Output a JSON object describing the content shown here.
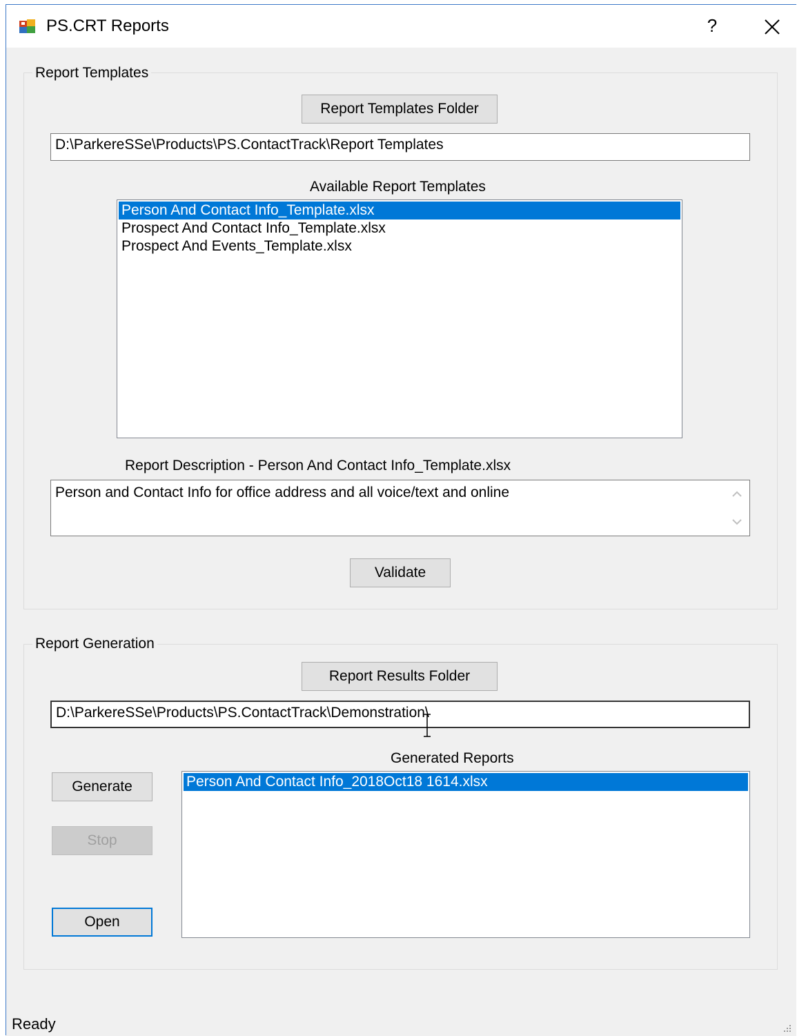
{
  "window": {
    "title": "PS.CRT Reports",
    "help_label": "?"
  },
  "templates_group": {
    "title": "Report Templates",
    "folder_button": "Report Templates Folder",
    "folder_path": "D:\\ParkereSSe\\Products\\PS.ContactTrack\\Report Templates",
    "available_label": "Available Report Templates",
    "items": [
      {
        "label": "Person And Contact Info_Template.xlsx",
        "selected": true
      },
      {
        "label": "Prospect And Contact Info_Template.xlsx",
        "selected": false
      },
      {
        "label": "Prospect And Events_Template.xlsx",
        "selected": false
      }
    ],
    "description_label": "Report Description - Person And Contact Info_Template.xlsx",
    "description_text": "Person and Contact Info for office address and all voice/text and online",
    "validate_button": "Validate"
  },
  "generation_group": {
    "title": "Report Generation",
    "results_button": "Report Results Folder",
    "results_path": "D:\\ParkereSSe\\Products\\PS.ContactTrack\\Demonstration\\",
    "generated_label": "Generated Reports",
    "generate_button": "Generate",
    "stop_button": "Stop",
    "open_button": "Open",
    "items": [
      {
        "label": "Person And Contact Info_2018Oct18 1614.xlsx",
        "selected": true
      }
    ]
  },
  "status": {
    "text": "Ready"
  },
  "colors": {
    "selection": "#0078d7",
    "window_bg": "#f0f0f0",
    "border_accent": "#3c78c8"
  }
}
